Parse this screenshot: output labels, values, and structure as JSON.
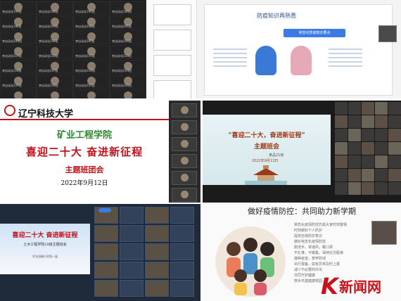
{
  "meeting_gallery": {
    "participants": [
      "李自动化19A班",
      "李自动化19B班",
      "李自动化19C班",
      "李自动化19D班",
      "李自动化19E班",
      "李自动化20A班",
      "李自动化20B班",
      "李自动化20C班",
      "李自动化20D班",
      "李自动化20E班",
      "李自动化20F班",
      "李自动化20G班",
      "李自动化21A班",
      "李自动化21B班",
      "李自动化21C班",
      "李自动化21D班",
      "李自动化21E班",
      "李自动化21F班",
      "李自动化21G班",
      "李自动化21H班",
      "李自动化22A班",
      "李自动化22B班",
      "李自动化22C班",
      "李自动化22D班",
      "李自动化22E班",
      "李自动化22F班",
      "李自动化22G班",
      "李自动化22H班"
    ]
  },
  "editor_slide": {
    "title": "防疫知识再熟悉",
    "banner": "常态化防疫知识要点",
    "text_lines": [
      "",
      "",
      "",
      ""
    ]
  },
  "title_slide": {
    "university": "辽宁科技大学",
    "college": "矿业工程学院",
    "slogan": "喜迎二十大  奋进新征程",
    "meeting": "主题班团会",
    "date": "2022年9月12日"
  },
  "theme_slide": {
    "headline": "“喜迎二十大，奋进新征程”",
    "subtitle": "主题班会",
    "small": "食品21级",
    "date": "2022年9月13日"
  },
  "blue_slide": {
    "headline": "喜迎二十大  奋进新征程",
    "subtitle": "土木工程学院18级主题班会",
    "sig": "学业班级行学团一届"
  },
  "prevention_slide": {
    "title": "做好疫情防控：共同助力新学期",
    "text_lines": [
      "常态化疫情防控仍需大家时刻警惕",
      "时刻做好个人防护",
      "提高自我防护意识",
      "做好常态化疫情防控",
      "勤洗手，常通风，戴口罩",
      "不扎堆，不聚集，保持社交距离",
      "接种疫苗，筑牢防线",
      "出行报备，如有异常及时上报",
      "减少不必要的外出",
      "共同守护健康",
      "携手共建健康校园"
    ],
    "logo_mark": "K",
    "logo_text": "新闻网"
  }
}
